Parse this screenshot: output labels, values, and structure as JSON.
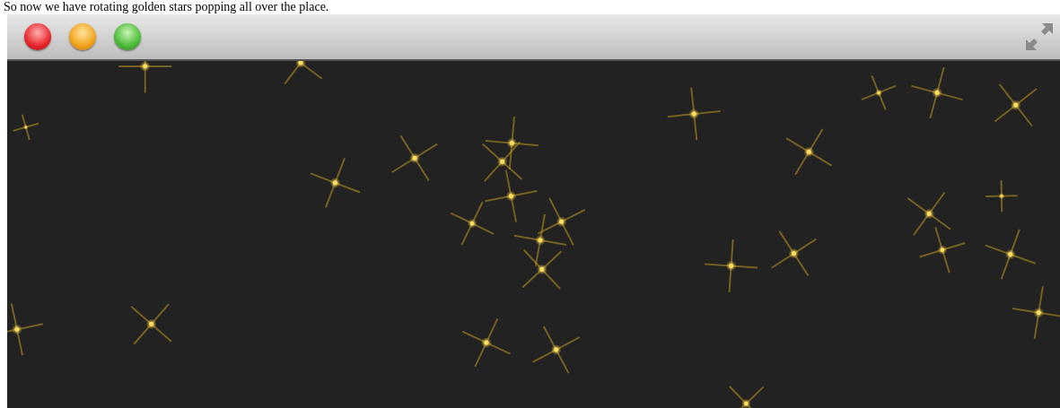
{
  "caption": "So now we have rotating golden stars popping all over the place.",
  "window": {
    "controls": [
      {
        "kind": "close"
      },
      {
        "kind": "minimize"
      },
      {
        "kind": "zoom"
      }
    ]
  }
}
